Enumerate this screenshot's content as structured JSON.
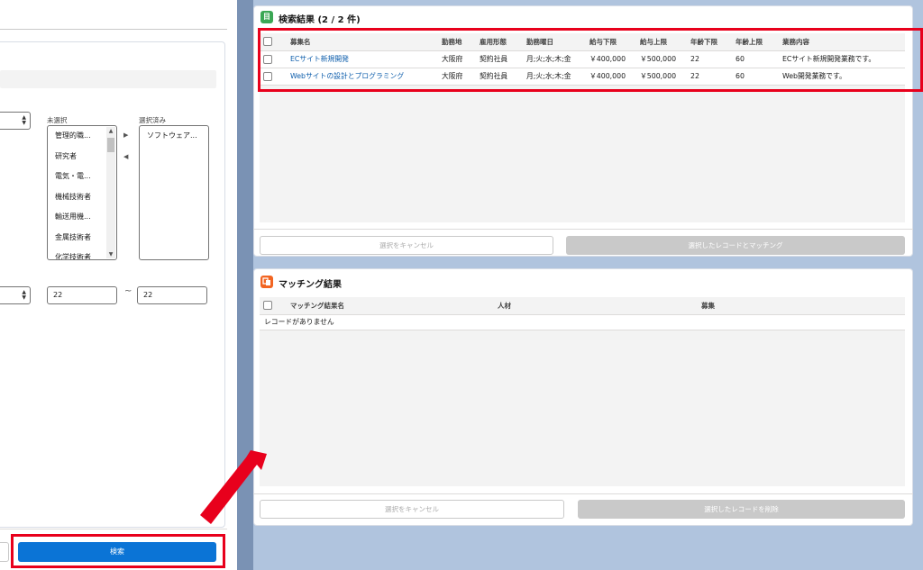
{
  "left_form": {
    "dual_list": {
      "unselected_label": "未選択",
      "selected_label": "選択済み",
      "unselected_items": [
        "管理的職...",
        "研究者",
        "電気・電...",
        "機械技術者",
        "輸送用機...",
        "金属技術者",
        "化学技術者"
      ],
      "selected_items": [
        "ソフトウェア..."
      ],
      "move_right_icon": "triangle-right-icon",
      "move_left_icon": "triangle-left-icon"
    },
    "age_from": "22",
    "age_to": "22",
    "range_separator": "~",
    "search_button": "検索"
  },
  "search_results": {
    "title": "検索結果 (2 / 2 件)",
    "icon": "clipboard-icon",
    "icon_glyph": "目",
    "icon_color": "#3ba755",
    "columns": [
      "募集名",
      "勤務地",
      "雇用形態",
      "勤務曜日",
      "給与下限",
      "給与上限",
      "年齢下限",
      "年齢上限",
      "業務内容"
    ],
    "rows": [
      [
        "ECサイト新規開発",
        "大阪府",
        "契約社員",
        "月;火;水;木;金",
        "￥400,000",
        "￥500,000",
        "22",
        "60",
        "ECサイト新規開発業務です。"
      ],
      [
        "Webサイトの設計とプログラミング",
        "大阪府",
        "契約社員",
        "月;火;水;木;金",
        "￥400,000",
        "￥500,000",
        "22",
        "60",
        "Web開発業務です。"
      ]
    ],
    "cancel_button": "選択をキャンセル",
    "match_button": "選択したレコードとマッチング"
  },
  "matching_results": {
    "title": "マッチング結果",
    "icon": "matching-icon",
    "icon_color": "#f26522",
    "columns": [
      "マッチング結果名",
      "人材",
      "募集"
    ],
    "empty_message": "レコードがありません",
    "cancel_button": "選択をキャンセル",
    "delete_button": "選択したレコードを削除"
  },
  "colors": {
    "brand_blue": "#0b74d6",
    "highlight_red": "#e8001c",
    "link": "#0b5cab",
    "background": "#b0c4de"
  }
}
